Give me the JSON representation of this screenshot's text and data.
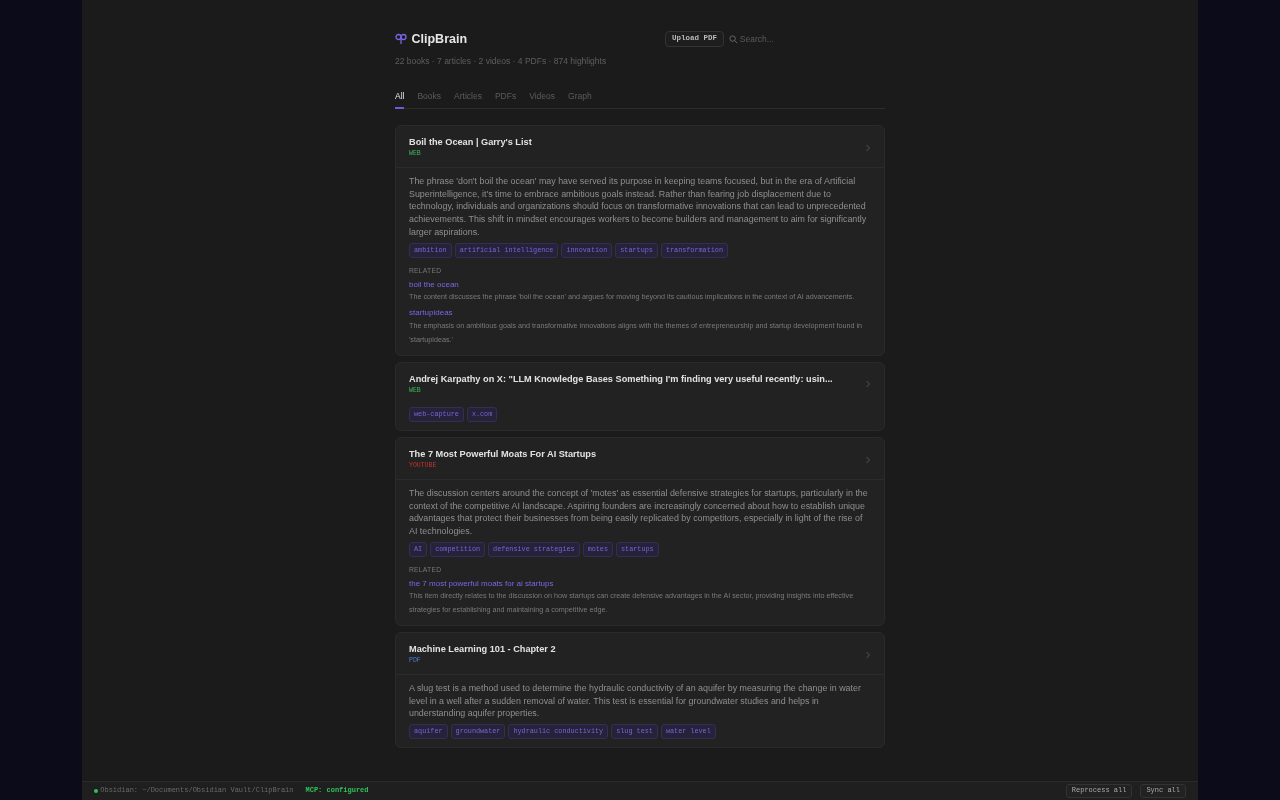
{
  "app": {
    "name": "ClipBrain",
    "upload_button": "Upload PDF",
    "search": {
      "placeholder": "Search..."
    },
    "stats": "22 books · 7 articles · 2 videos · 4 PDFs · 874 highlights"
  },
  "tabs": [
    {
      "label": "All",
      "selected": true
    },
    {
      "label": "Books",
      "selected": false
    },
    {
      "label": "Articles",
      "selected": false
    },
    {
      "label": "PDFs",
      "selected": false
    },
    {
      "label": "Videos",
      "selected": false
    },
    {
      "label": "Graph",
      "selected": false
    }
  ],
  "items": [
    {
      "title": "Boil the Ocean | Garry's List",
      "source": {
        "kind": "web",
        "label": "WEB"
      },
      "summary": "The phrase 'don't boil the ocean' may have served its purpose in keeping teams focused, but in the era of Artificial Superintelligence, it's time to embrace ambitious goals instead. Rather than fearing job displacement due to technology, individuals and organizations should focus on transformative innovations that can lead to unprecedented achievements. This shift in mindset encourages workers to become builders and management to aim for significantly larger aspirations.",
      "tags": [
        "ambition",
        "artificial intelligence",
        "innovation",
        "startups",
        "transformation"
      ],
      "related_label": "RELATED",
      "related": [
        {
          "link": "boil the ocean",
          "note": "The content discusses the phrase 'boil the ocean' and argues for moving beyond its cautious implications in the context of AI advancements."
        },
        {
          "link": "startupideas",
          "note": "The emphasis on ambitious goals and transformative innovations aligns with the themes of entrepreneurship and startup development found in 'startupideas.'"
        }
      ]
    },
    {
      "title": "Andrej Karpathy on X: \"LLM Knowledge Bases Something I'm finding very useful recently: usin...",
      "source": {
        "kind": "web",
        "label": "WEB"
      },
      "tags": [
        "web-capture",
        "x.com"
      ]
    },
    {
      "title": "The 7 Most Powerful Moats For AI Startups",
      "source": {
        "kind": "youtube",
        "label": "YOUTUBE"
      },
      "summary": "The discussion centers around the concept of 'motes' as essential defensive strategies for startups, particularly in the context of the competitive AI landscape. Aspiring founders are increasingly concerned about how to establish unique advantages that protect their businesses from being easily replicated by competitors, especially in light of the rise of AI technologies.",
      "tags": [
        "AI",
        "competition",
        "defensive strategies",
        "motes",
        "startups"
      ],
      "related_label": "RELATED",
      "related": [
        {
          "link": "the 7 most powerful moats for ai startups",
          "note": "This item directly relates to the discussion on how startups can create defensive advantages in the AI sector, providing insights into effective strategies for establishing and maintaining a competitive edge."
        }
      ]
    },
    {
      "title": "Machine Learning 101 - Chapter 2",
      "source": {
        "kind": "pdf",
        "label": "PDF"
      },
      "summary": "A slug test is a method used to determine the hydraulic conductivity of an aquifer by measuring the change in water level in a well after a sudden removal of water. This test is essential for groundwater studies and helps in understanding aquifer properties.",
      "tags": [
        "aquifer",
        "groundwater",
        "hydraulic conductivity",
        "slug test",
        "water level"
      ]
    }
  ],
  "status_bar": {
    "connected": true,
    "vault": "Obsidian: ~/Documents/Obsidian Vault/ClipBrain",
    "mcp": "MCP: configured",
    "buttons": [
      "Reprocess all",
      "Sync all"
    ]
  }
}
